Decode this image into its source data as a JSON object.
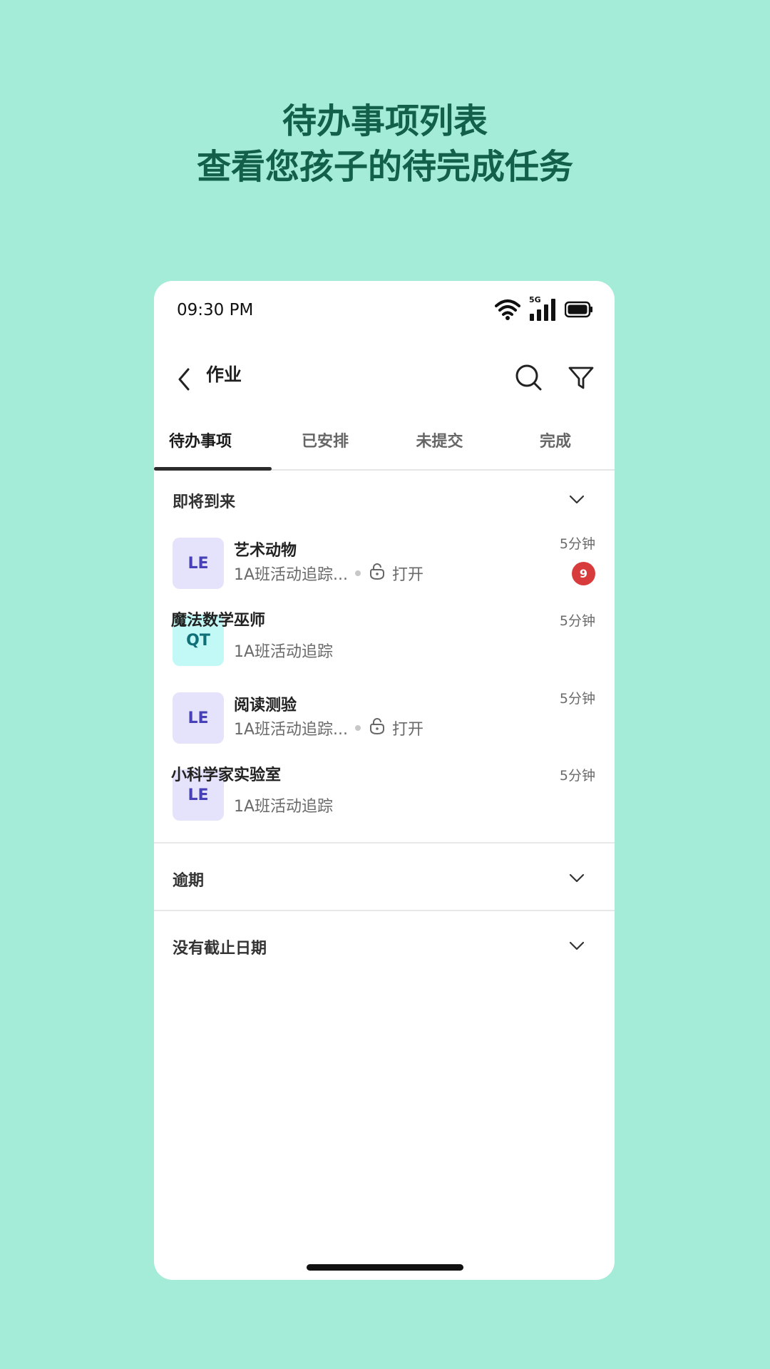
{
  "headline": {
    "line1": "待办事项列表",
    "line2": "查看您孩子的待完成任务"
  },
  "status_bar": {
    "time": "09:30 PM",
    "network": "5G",
    "icons": [
      "wifi-icon",
      "signal-icon",
      "battery-icon"
    ]
  },
  "topbar": {
    "title": "作业",
    "icons": [
      "back-arrow-icon",
      "search-icon",
      "filter-icon"
    ]
  },
  "tabs": [
    {
      "label": "待办事项",
      "active": true
    },
    {
      "label": "已安排",
      "active": false
    },
    {
      "label": "未提交",
      "active": false
    },
    {
      "label": "完成",
      "active": false
    }
  ],
  "sections": {
    "upcoming": {
      "title": "即将到来"
    },
    "overdue": {
      "title": "逾期"
    },
    "no_due_date": {
      "title": "没有截止日期"
    }
  },
  "items": [
    {
      "avatar": "LE",
      "title": "艺术动物",
      "subtitle": "1A班活动追踪...",
      "status": "打开",
      "time": "5分钟",
      "badge": "9"
    },
    {
      "avatar": "QT",
      "title": "魔法数学巫师",
      "subtitle": "1A班活动追踪",
      "time": "5分钟"
    },
    {
      "avatar": "LE",
      "title": "阅读测验",
      "subtitle": "1A班活动追踪...",
      "status": "打开",
      "time": "5分钟"
    },
    {
      "avatar": "LE",
      "title": "小科学家实验室",
      "subtitle": "1A班活动追踪",
      "time": "5分钟"
    }
  ],
  "colors": {
    "background": "#a4ecd7",
    "headline": "#13604a",
    "avatar_le_bg": "#e4e3fb",
    "avatar_le_text": "#4741b8",
    "avatar_qt_bg": "#c2f8f6",
    "avatar_qt_text": "#0f6f77",
    "badge": "#d83b3b"
  }
}
